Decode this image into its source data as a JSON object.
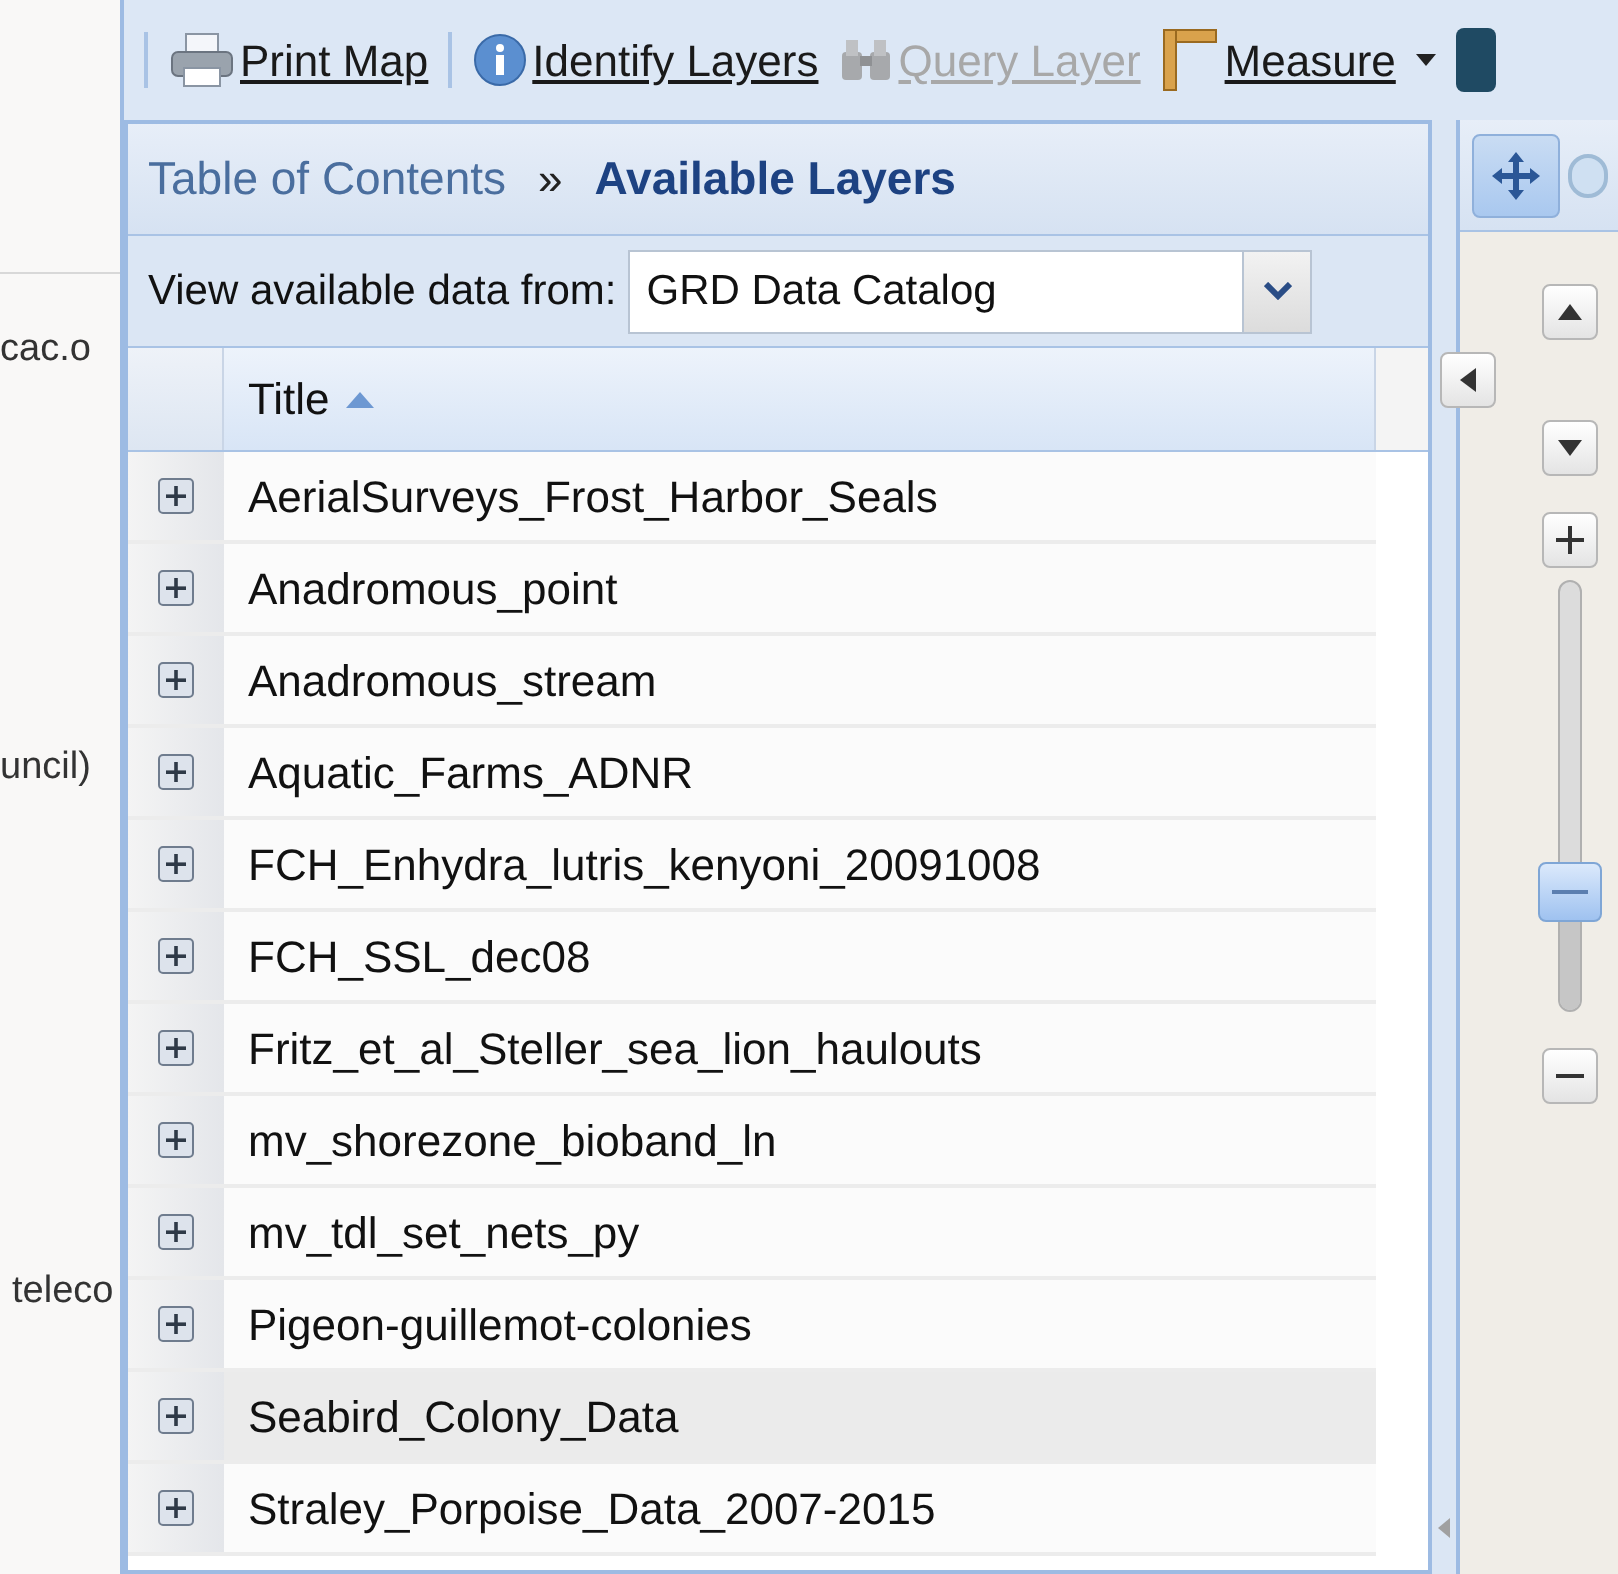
{
  "side_panel": {
    "texts": [
      "cac.o",
      "uncil)",
      "teleco"
    ]
  },
  "toolbar": {
    "items": [
      {
        "kind": "print",
        "label": "Print Map",
        "disabled": false
      },
      {
        "kind": "info",
        "label": "Identify Layers",
        "disabled": false
      },
      {
        "kind": "query",
        "label": "Query Layer",
        "disabled": true
      },
      {
        "kind": "measure",
        "label": "Measure",
        "disabled": false,
        "dropdown": true
      }
    ]
  },
  "breadcrumb": {
    "parent": "Table of Contents",
    "separator": "»",
    "current": "Available Layers"
  },
  "source": {
    "label": "View available data from:",
    "value": "GRD Data Catalog"
  },
  "table": {
    "columns": [
      {
        "title": "Title",
        "sorted_ascending": true
      }
    ],
    "rows": [
      {
        "title": "AerialSurveys_Frost_Harbor_Seals",
        "selected": false
      },
      {
        "title": "Anadromous_point",
        "selected": false
      },
      {
        "title": "Anadromous_stream",
        "selected": false
      },
      {
        "title": "Aquatic_Farms_ADNR",
        "selected": false
      },
      {
        "title": "FCH_Enhydra_lutris_kenyoni_20091008",
        "selected": false
      },
      {
        "title": "FCH_SSL_dec08",
        "selected": false
      },
      {
        "title": "Fritz_et_al_Steller_sea_lion_haulouts",
        "selected": false
      },
      {
        "title": "mv_shorezone_bioband_ln",
        "selected": false
      },
      {
        "title": "mv_tdl_set_nets_py",
        "selected": false
      },
      {
        "title": "Pigeon-guillemot-colonies",
        "selected": false
      },
      {
        "title": "Seabird_Colony_Data",
        "selected": true
      },
      {
        "title": "Straley_Porpoise_Data_2007-2015",
        "selected": false
      }
    ]
  },
  "map": {
    "pan_tool_selected": true,
    "zoom_slider": {
      "level": 0.28
    }
  }
}
